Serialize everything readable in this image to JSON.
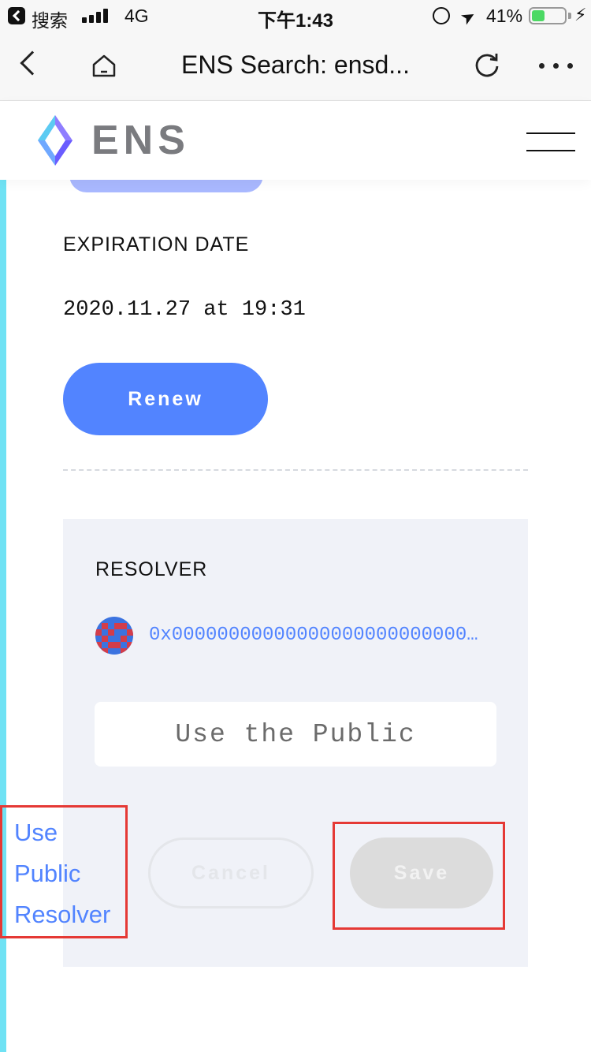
{
  "status_bar": {
    "back_app": "搜索",
    "network": "4G",
    "time": "下午1:43",
    "battery_percent": "41%",
    "battery_level": 0.41,
    "icons": [
      "back-app-icon",
      "signal-icon",
      "lock-rotation-icon",
      "location-icon",
      "battery-icon",
      "charging-icon"
    ]
  },
  "nav_bar": {
    "title": "ENS Search: ensd...",
    "icons": [
      "back-icon",
      "home-icon",
      "reload-icon",
      "more-icon"
    ]
  },
  "ens_header": {
    "brand": "ENS",
    "icons": [
      "ens-logo-icon",
      "hamburger-menu-icon"
    ]
  },
  "expiration": {
    "label": "EXPIRATION DATE",
    "value": "2020.11.27 at 19:31",
    "renew_label": "Renew"
  },
  "resolver": {
    "label": "RESOLVER",
    "address": "0x0000000000000000000000000000000000000000",
    "input_value": "Use the Public",
    "cancel_label": "Cancel",
    "save_label": "Save"
  },
  "use_public_resolver": {
    "lines": [
      "Use",
      "Public",
      "Resolver"
    ]
  },
  "colors": {
    "accent": "#5284ff",
    "left_stripe": "#6fe2f4",
    "panel_bg": "#f0f2f8",
    "highlight": "#e53935",
    "ens_gray": "#7a7b7f"
  }
}
